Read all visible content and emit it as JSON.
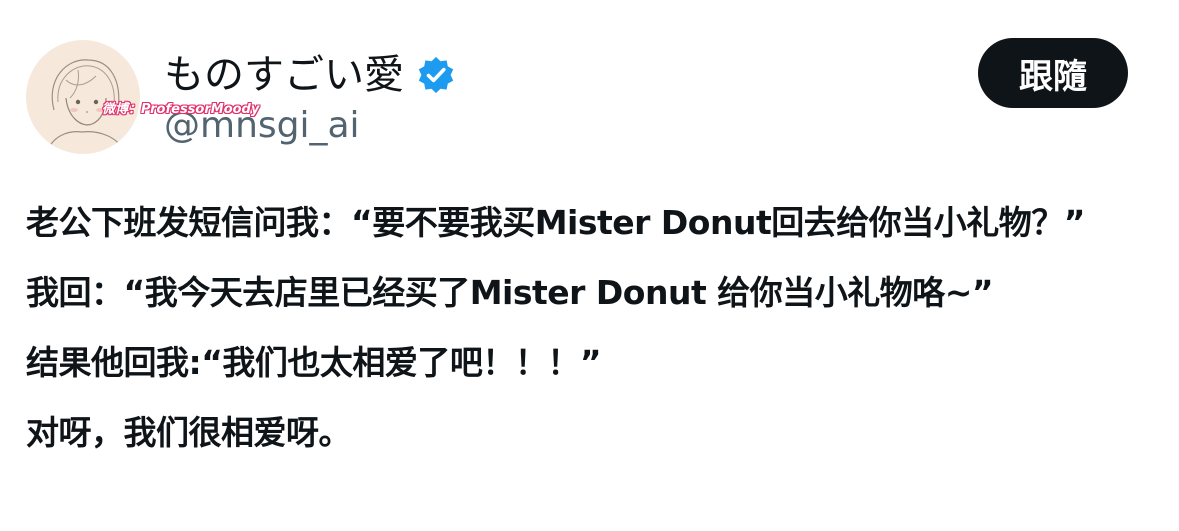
{
  "profile": {
    "display_name": "ものすごい愛",
    "handle": "@mnsgi_ai",
    "verified": true,
    "watermark": "微博：ProfessorMoody",
    "avatar_icon": "sketch-portrait-avatar"
  },
  "actions": {
    "follow_label": "跟隨"
  },
  "tweet": {
    "lines": [
      "老公下班发短信问我：“要不要我买Mister Donut回去给你当小礼物？”",
      "我回：“我今天去店里已经买了Mister Donut 给你当小礼物咯~”",
      "结果他回我:“我们也太相爱了吧！！！”",
      "对呀，我们很相爱呀。"
    ]
  },
  "colors": {
    "text_primary": "#0f1419",
    "text_secondary": "#536471",
    "verified_blue": "#1d9bf0",
    "follow_bg": "#0f1419",
    "avatar_bg": "#f6e9dc"
  }
}
